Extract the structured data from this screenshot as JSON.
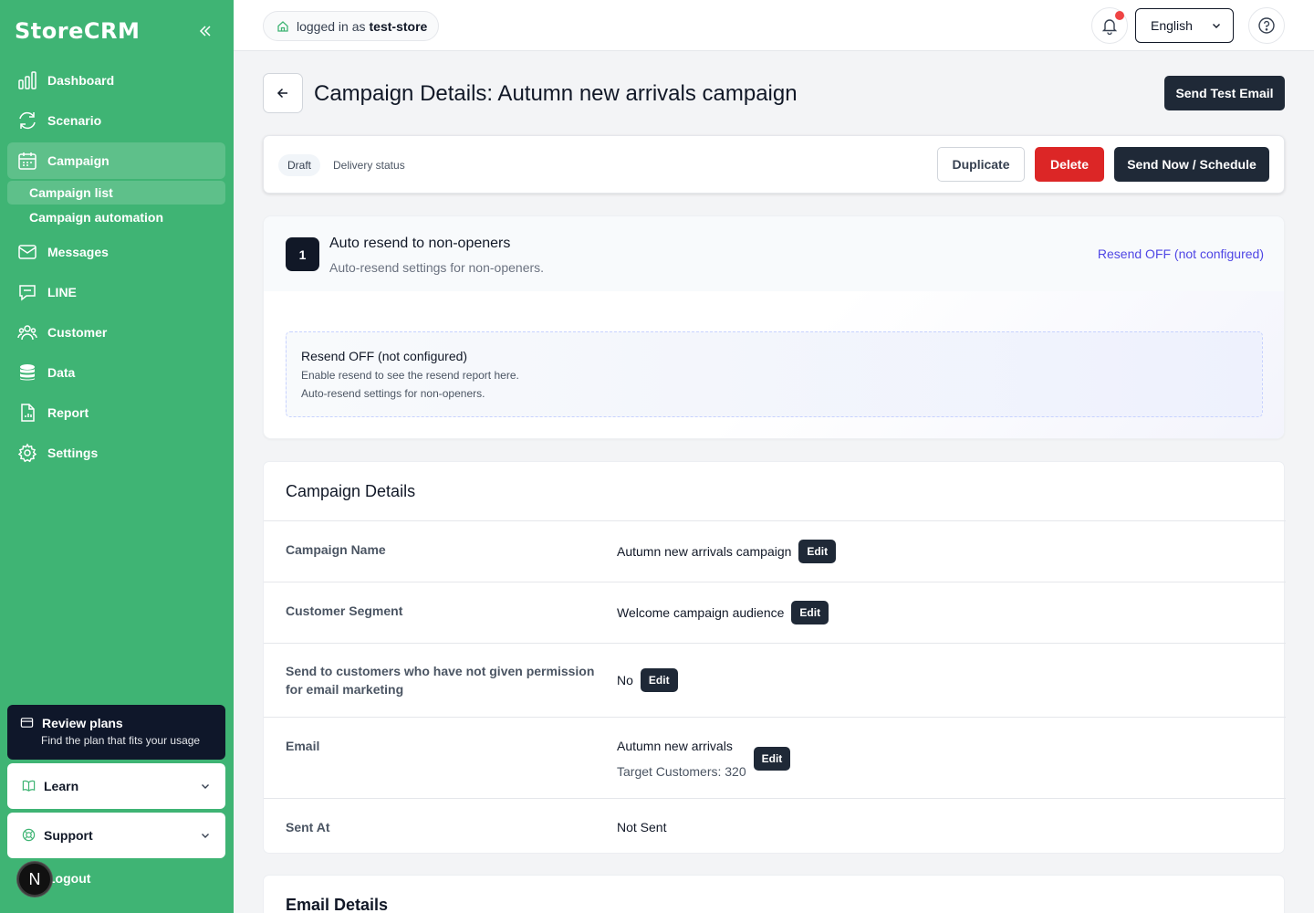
{
  "brand": "StoreCRM",
  "sidebar": {
    "nav": [
      {
        "label": "Dashboard",
        "icon": "bar-chart-icon"
      },
      {
        "label": "Scenario",
        "icon": "refresh-icon"
      },
      {
        "label": "Campaign",
        "icon": "calendar-icon"
      },
      {
        "label": "Messages",
        "icon": "mail-icon"
      },
      {
        "label": "LINE",
        "icon": "chat-icon"
      },
      {
        "label": "Customer",
        "icon": "users-icon"
      },
      {
        "label": "Data",
        "icon": "database-icon"
      },
      {
        "label": "Report",
        "icon": "file-chart-icon"
      },
      {
        "label": "Settings",
        "icon": "gear-icon"
      }
    ],
    "campaign_sub": [
      "Campaign list",
      "Campaign automation"
    ],
    "plans": {
      "title": "Review plans",
      "subtitle": "Find the plan that fits your usage"
    },
    "learn": "Learn",
    "support": "Support",
    "logout": "Logout",
    "badge": "N"
  },
  "topbar": {
    "login_prefix": "logged in as",
    "store": "test-store",
    "language": "English"
  },
  "page": {
    "title": "Campaign Details: Autumn new arrivals campaign",
    "send_test": "Send Test Email"
  },
  "status": {
    "badge": "Draft",
    "delivery": "Delivery status",
    "duplicate": "Duplicate",
    "delete": "Delete",
    "send": "Send Now / Schedule"
  },
  "resend": {
    "step": "1",
    "title": "Auto resend to non-openers",
    "subtitle": "Auto-resend settings for non-openers.",
    "status": "Resend OFF (not configured)",
    "box_title": "Resend OFF (not configured)",
    "box_line1": "Enable resend to see the resend report here.",
    "box_line2": "Auto-resend settings for non-openers."
  },
  "details": {
    "title": "Campaign Details",
    "edit": "Edit",
    "rows": [
      {
        "key": "Campaign Name",
        "value": "Autumn new arrivals campaign"
      },
      {
        "key": "Customer Segment",
        "value": "Welcome campaign audience"
      },
      {
        "key": "Send to customers who have not given permission for email marketing",
        "value": "No"
      },
      {
        "key": "Email",
        "value": "Autumn new arrivals",
        "value2": "Target Customers: 320"
      },
      {
        "key": "Sent At",
        "value": "Not Sent"
      }
    ]
  },
  "email_details": {
    "title": "Email Details"
  },
  "colors": {
    "sidebar": "#3fb474",
    "dark": "#1f2937",
    "danger": "#dc2626",
    "accent": "#4f46e5"
  }
}
